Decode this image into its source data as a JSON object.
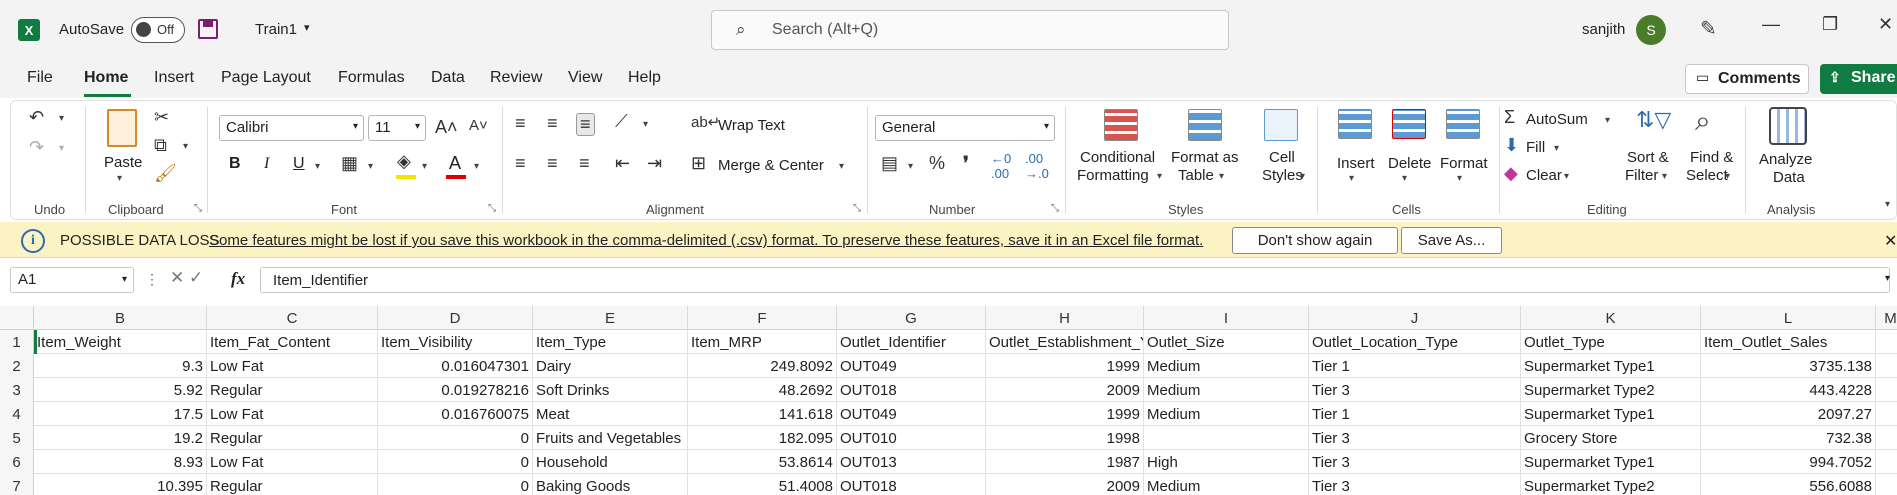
{
  "titlebar": {
    "autosave_label": "AutoSave",
    "autosave_state": "Off",
    "filename": "Train1",
    "search_placeholder": "Search (Alt+Q)",
    "username": "sanjith",
    "avatar_initial": "S"
  },
  "menu": {
    "tabs": [
      "File",
      "Home",
      "Insert",
      "Page Layout",
      "Formulas",
      "Data",
      "Review",
      "View",
      "Help"
    ],
    "comments": "Comments",
    "share": "Share"
  },
  "ribbon": {
    "undo_group": "Undo",
    "clipboard": {
      "paste": "Paste",
      "group": "Clipboard"
    },
    "font": {
      "name": "Calibri",
      "size": "11",
      "group": "Font"
    },
    "alignment": {
      "wrap": "Wrap Text",
      "merge": "Merge & Center",
      "group": "Alignment"
    },
    "number": {
      "format": "General",
      "group": "Number"
    },
    "styles": {
      "conditional_1": "Conditional",
      "conditional_2": "Formatting",
      "format_table_1": "Format as",
      "format_table_2": "Table",
      "cell_styles_1": "Cell",
      "cell_styles_2": "Styles",
      "group": "Styles"
    },
    "cells": {
      "insert": "Insert",
      "delete": "Delete",
      "format": "Format",
      "group": "Cells"
    },
    "editing": {
      "autosum": "AutoSum",
      "fill": "Fill",
      "clear": "Clear",
      "sort_1": "Sort &",
      "sort_2": "Filter",
      "find_1": "Find &",
      "find_2": "Select",
      "group": "Editing"
    },
    "analysis": {
      "analyze_1": "Analyze",
      "analyze_2": "Data",
      "group": "Analysis"
    }
  },
  "infobar": {
    "title": "POSSIBLE DATA LOSS",
    "message": "Some features might be lost if you save this workbook in the comma-delimited (.csv) format. To preserve these features, save it in an Excel file format.",
    "dont_show": "Don't show again",
    "save_as": "Save As..."
  },
  "formula_bar": {
    "namebox": "A1",
    "content": "Item_Identifier"
  },
  "grid": {
    "columns": [
      "B",
      "C",
      "D",
      "E",
      "F",
      "G",
      "H",
      "I",
      "J",
      "K",
      "L",
      "M"
    ],
    "row_numbers": [
      "1",
      "2",
      "3",
      "4",
      "5",
      "6",
      "7"
    ],
    "header_row": [
      "Item_Weight",
      "Item_Fat_Content",
      "Item_Visibility",
      "Item_Type",
      "Item_MRP",
      "Outlet_Identifier",
      "Outlet_Establishment_Year",
      "Outlet_Size",
      "Outlet_Location_Type",
      "Outlet_Type",
      "Item_Outlet_Sales",
      ""
    ],
    "rows": [
      [
        "9.3",
        "Low Fat",
        "0.016047301",
        "Dairy",
        "249.8092",
        "OUT049",
        "1999",
        "Medium",
        "Tier 1",
        "Supermarket Type1",
        "3735.138",
        ""
      ],
      [
        "5.92",
        "Regular",
        "0.019278216",
        "Soft Drinks",
        "48.2692",
        "OUT018",
        "2009",
        "Medium",
        "Tier 3",
        "Supermarket Type2",
        "443.4228",
        ""
      ],
      [
        "17.5",
        "Low Fat",
        "0.016760075",
        "Meat",
        "141.618",
        "OUT049",
        "1999",
        "Medium",
        "Tier 1",
        "Supermarket Type1",
        "2097.27",
        ""
      ],
      [
        "19.2",
        "Regular",
        "0",
        "Fruits and Vegetables",
        "182.095",
        "OUT010",
        "1998",
        "",
        "Tier 3",
        "Grocery Store",
        "732.38",
        ""
      ],
      [
        "8.93",
        "Low Fat",
        "0",
        "Household",
        "53.8614",
        "OUT013",
        "1987",
        "High",
        "Tier 3",
        "Supermarket Type1",
        "994.7052",
        ""
      ],
      [
        "10.395",
        "Regular",
        "0",
        "Baking Goods",
        "51.4008",
        "OUT018",
        "2009",
        "Medium",
        "Tier 3",
        "Supermarket Type2",
        "556.6088",
        ""
      ]
    ],
    "numeric_columns": [
      0,
      2,
      4,
      6,
      10
    ]
  }
}
